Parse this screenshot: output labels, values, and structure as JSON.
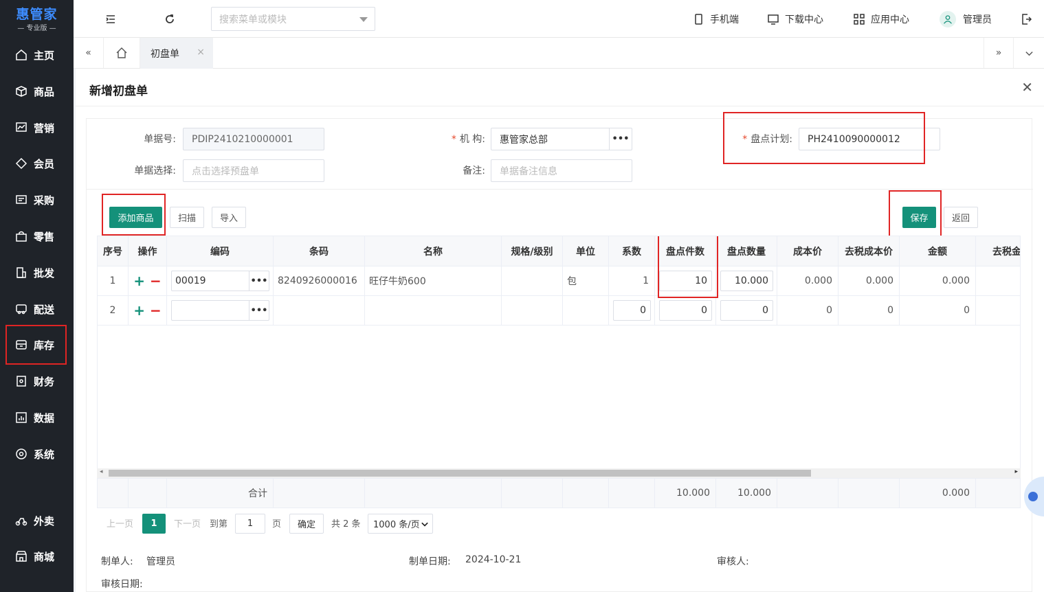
{
  "logo": {
    "brand": "惠管家",
    "edition": "专业版"
  },
  "sidebar": {
    "items": [
      {
        "label": "主页",
        "icon": "home-icon"
      },
      {
        "label": "商品",
        "icon": "box-icon"
      },
      {
        "label": "营销",
        "icon": "chart-icon"
      },
      {
        "label": "会员",
        "icon": "diamond-icon"
      },
      {
        "label": "采购",
        "icon": "purchase-icon"
      },
      {
        "label": "零售",
        "icon": "bag-icon"
      },
      {
        "label": "批发",
        "icon": "building-icon"
      },
      {
        "label": "配送",
        "icon": "truck-icon"
      },
      {
        "label": "库存",
        "icon": "warehouse-icon",
        "highlight": true
      },
      {
        "label": "财务",
        "icon": "finance-icon"
      },
      {
        "label": "数据",
        "icon": "data-icon"
      },
      {
        "label": "系统",
        "icon": "settings-icon"
      },
      {
        "label": "外卖",
        "icon": "scooter-icon"
      },
      {
        "label": "商城",
        "icon": "store-icon"
      }
    ]
  },
  "topbar": {
    "search_placeholder": "搜索菜单或模块",
    "mobile": "手机端",
    "download": "下载中心",
    "apps": "应用中心",
    "user": "管理员"
  },
  "tabs": {
    "active": "初盘单"
  },
  "page": {
    "title": "新增初盘单"
  },
  "form": {
    "doc_no_label": "单据号:",
    "doc_no_value": "PDIP2410210000001",
    "org_label": "机 构:",
    "org_value": "惠管家总部",
    "plan_label": "盘点计划:",
    "plan_value": "PH2410090000012",
    "select_label": "单据选择:",
    "select_placeholder": "点击选择预盘单",
    "remark_label": "备注:",
    "remark_placeholder": "单据备注信息"
  },
  "toolbar": {
    "add": "添加商品",
    "scan": "扫描",
    "import": "导入",
    "save": "保存",
    "back": "返回"
  },
  "table": {
    "headers": [
      "序号",
      "操作",
      "编码",
      "条码",
      "名称",
      "规格/级别",
      "单位",
      "系数",
      "盘点件数",
      "盘点数量",
      "成本价",
      "去税成本价",
      "金额",
      "去税金"
    ],
    "rows": [
      {
        "no": "1",
        "code": "00019",
        "barcode": "8240926000016",
        "name": "旺仔牛奶600",
        "spec": "",
        "unit": "包",
        "factor": "1",
        "count_pcs": "10",
        "count_qty": "10.000",
        "cost": "0.000",
        "cost_notax": "0.000",
        "amount": "0.000"
      },
      {
        "no": "2",
        "code": "",
        "barcode": "",
        "name": "",
        "spec": "",
        "unit": "",
        "factor": "0",
        "count_pcs": "0",
        "count_qty": "0",
        "cost": "0",
        "cost_notax": "0",
        "amount": "0"
      }
    ],
    "summary": {
      "label": "合计",
      "count_pcs": "10.000",
      "count_qty": "10.000",
      "amount": "0.000"
    }
  },
  "pager": {
    "prev": "上一页",
    "current": "1",
    "next": "下一页",
    "goto": "到第",
    "goto_value": "1",
    "page_unit": "页",
    "confirm": "确定",
    "total": "共 2 条",
    "size": "1000 条/页"
  },
  "footer": {
    "maker_label": "制单人:",
    "maker_value": "管理员",
    "date_label": "制单日期:",
    "date_value": "2024-10-21",
    "auditor_label": "审核人:",
    "audit_date_label": "审核日期:"
  },
  "colors": {
    "primary": "#14917a",
    "highlight": "#e02424",
    "sidebar": "#1f2329",
    "brand": "#3d8cff"
  }
}
